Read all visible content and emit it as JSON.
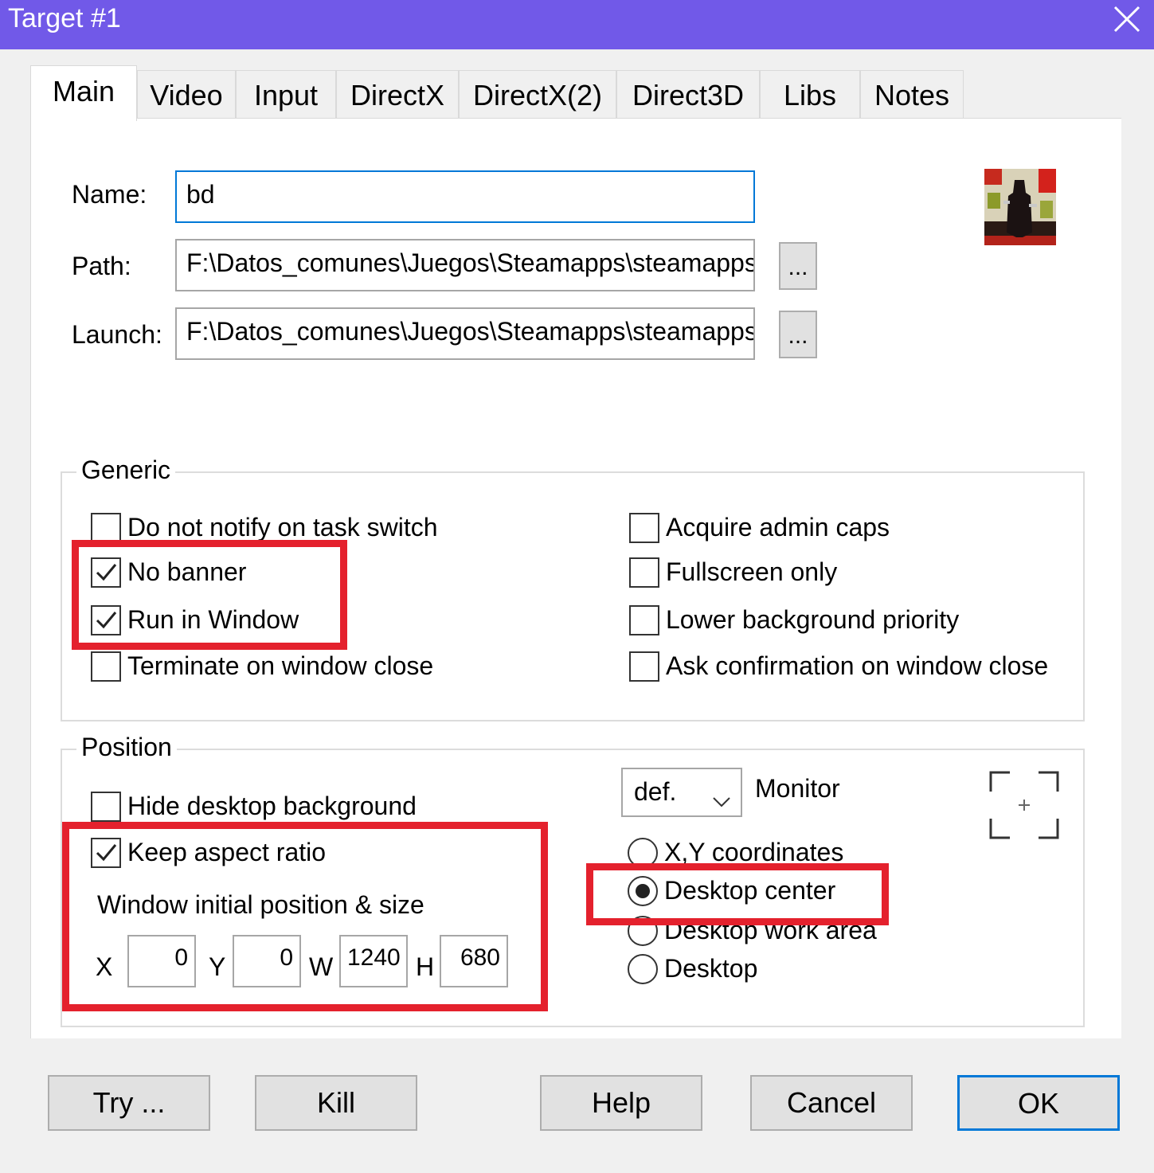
{
  "window": {
    "title": "Target #1"
  },
  "tabs": [
    {
      "label": "Main",
      "active": true
    },
    {
      "label": "Video"
    },
    {
      "label": "Input"
    },
    {
      "label": "DirectX"
    },
    {
      "label": "DirectX(2)"
    },
    {
      "label": "Direct3D"
    },
    {
      "label": "Libs"
    },
    {
      "label": "Notes"
    }
  ],
  "main": {
    "name_label": "Name:",
    "name_value": "bd",
    "path_label": "Path:",
    "path_value": "F:\\Datos_comunes\\Juegos\\Steamapps\\steamapps",
    "launch_label": "Launch:",
    "launch_value": "F:\\Datos_comunes\\Juegos\\Steamapps\\steamapps",
    "browse_label": "...",
    "icon": "game-icon"
  },
  "generic": {
    "title": "Generic",
    "options": [
      {
        "label": "Do not notify on task switch",
        "checked": false
      },
      {
        "label": "No banner",
        "checked": true
      },
      {
        "label": "Run in Window",
        "checked": true
      },
      {
        "label": "Terminate on window close",
        "checked": false
      },
      {
        "label": "Acquire admin caps",
        "checked": false
      },
      {
        "label": "Fullscreen only",
        "checked": false
      },
      {
        "label": "Lower background priority",
        "checked": false
      },
      {
        "label": "Ask confirmation on window close",
        "checked": false
      }
    ]
  },
  "position": {
    "title": "Position",
    "hide_desktop": {
      "label": "Hide desktop background",
      "checked": false
    },
    "keep_aspect": {
      "label": "Keep aspect ratio",
      "checked": true
    },
    "initial_label": "Window initial position & size",
    "x_label": "X",
    "x_value": "0",
    "y_label": "Y",
    "y_value": "0",
    "w_label": "W",
    "w_value": "1240",
    "h_label": "H",
    "h_value": "680",
    "monitor_value": "def.",
    "monitor_label": "Monitor",
    "radios": [
      {
        "label": "X,Y coordinates",
        "selected": false
      },
      {
        "label": "Desktop center",
        "selected": true
      },
      {
        "label": "Desktop work area",
        "selected": false
      },
      {
        "label": "Desktop",
        "selected": false
      }
    ]
  },
  "buttons": {
    "try": "Try ...",
    "kill": "Kill",
    "help": "Help",
    "cancel": "Cancel",
    "ok": "OK"
  },
  "colors": {
    "titlebar": "#7159e8",
    "highlight": "#e4212d",
    "focus": "#0078d7"
  }
}
